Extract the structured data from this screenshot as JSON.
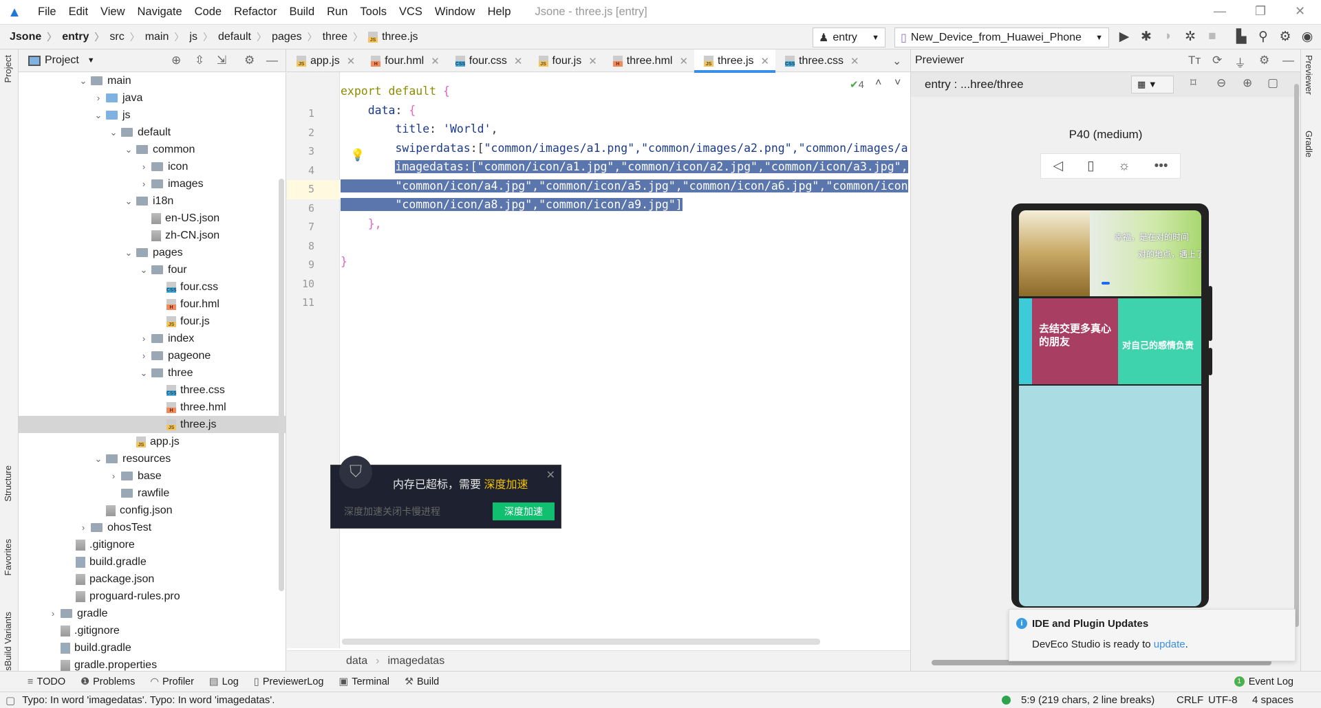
{
  "menubar": {
    "items": [
      "File",
      "Edit",
      "View",
      "Navigate",
      "Code",
      "Refactor",
      "Build",
      "Run",
      "Tools",
      "VCS",
      "Window",
      "Help"
    ],
    "title": "Jsone - three.js [entry]"
  },
  "breadcrumb": [
    "Jsone",
    "entry",
    "src",
    "main",
    "js",
    "default",
    "pages",
    "three",
    "three.js"
  ],
  "toolbar": {
    "module": "entry",
    "device": "New_Device_from_Huawei_Phone"
  },
  "sidestripe": {
    "project": "Project",
    "structure": "Structure",
    "favorites": "Favorites",
    "variants": "OhosBuild Variants",
    "previewer": "Previewer",
    "gradle": "Gradle"
  },
  "project": {
    "title": "Project",
    "tree": [
      {
        "label": "main",
        "depth": 4,
        "type": "folder",
        "open": true
      },
      {
        "label": "java",
        "depth": 5,
        "type": "folder-blue",
        "open": false
      },
      {
        "label": "js",
        "depth": 5,
        "type": "folder-blue",
        "open": true
      },
      {
        "label": "default",
        "depth": 6,
        "type": "folder",
        "open": true
      },
      {
        "label": "common",
        "depth": 7,
        "type": "folder",
        "open": true
      },
      {
        "label": "icon",
        "depth": 8,
        "type": "folder",
        "open": false
      },
      {
        "label": "images",
        "depth": 8,
        "type": "folder",
        "open": false
      },
      {
        "label": "i18n",
        "depth": 7,
        "type": "folder",
        "open": true
      },
      {
        "label": "en-US.json",
        "depth": 8,
        "type": "json"
      },
      {
        "label": "zh-CN.json",
        "depth": 8,
        "type": "json"
      },
      {
        "label": "pages",
        "depth": 7,
        "type": "folder",
        "open": true
      },
      {
        "label": "four",
        "depth": 8,
        "type": "folder",
        "open": true
      },
      {
        "label": "four.css",
        "depth": 9,
        "type": "css"
      },
      {
        "label": "four.hml",
        "depth": 9,
        "type": "h"
      },
      {
        "label": "four.js",
        "depth": 9,
        "type": "js"
      },
      {
        "label": "index",
        "depth": 8,
        "type": "folder",
        "open": false
      },
      {
        "label": "pageone",
        "depth": 8,
        "type": "folder",
        "open": false
      },
      {
        "label": "three",
        "depth": 8,
        "type": "folder",
        "open": true
      },
      {
        "label": "three.css",
        "depth": 9,
        "type": "css"
      },
      {
        "label": "three.hml",
        "depth": 9,
        "type": "h"
      },
      {
        "label": "three.js",
        "depth": 9,
        "type": "js",
        "selected": true
      },
      {
        "label": "app.js",
        "depth": 7,
        "type": "js"
      },
      {
        "label": "resources",
        "depth": 5,
        "type": "folder",
        "open": true
      },
      {
        "label": "base",
        "depth": 6,
        "type": "folder",
        "open": false
      },
      {
        "label": "rawfile",
        "depth": 6,
        "type": "folder-leaf"
      },
      {
        "label": "config.json",
        "depth": 5,
        "type": "json"
      },
      {
        "label": "ohosTest",
        "depth": 4,
        "type": "folder",
        "open": false
      },
      {
        "label": ".gitignore",
        "depth": 3,
        "type": "file"
      },
      {
        "label": "build.gradle",
        "depth": 3,
        "type": "gradle"
      },
      {
        "label": "package.json",
        "depth": 3,
        "type": "json"
      },
      {
        "label": "proguard-rules.pro",
        "depth": 3,
        "type": "file"
      },
      {
        "label": "gradle",
        "depth": 2,
        "type": "folder",
        "open": false
      },
      {
        "label": ".gitignore",
        "depth": 2,
        "type": "file"
      },
      {
        "label": "build.gradle",
        "depth": 2,
        "type": "gradle"
      },
      {
        "label": "gradle.properties",
        "depth": 2,
        "type": "file"
      }
    ]
  },
  "tabs": [
    {
      "label": "app.js",
      "type": "js"
    },
    {
      "label": "four.hml",
      "type": "h"
    },
    {
      "label": "four.css",
      "type": "css"
    },
    {
      "label": "four.js",
      "type": "js"
    },
    {
      "label": "three.hml",
      "type": "h"
    },
    {
      "label": "three.js",
      "type": "js",
      "active": true
    },
    {
      "label": "three.css",
      "type": "css"
    }
  ],
  "editor": {
    "inspection_count": "4",
    "caret_line": 5,
    "lines": [
      [
        {
          "t": "export default ",
          "c": "kw"
        },
        {
          "t": "{",
          "c": "br"
        }
      ],
      [
        {
          "t": "    data",
          "c": "prop"
        },
        {
          "t": ": ",
          "c": "pl"
        },
        {
          "t": "{",
          "c": "br"
        }
      ],
      [
        {
          "t": "        title",
          "c": "prop"
        },
        {
          "t": ": ",
          "c": "pl"
        },
        {
          "t": "'World'",
          "c": "str"
        },
        {
          "t": ",",
          "c": "pl"
        }
      ],
      [
        {
          "t": "        swiperdatas",
          "c": "prop"
        },
        {
          "t": ":[",
          "c": "pl"
        },
        {
          "t": "\"common/images/a1.png\",\"common/images/a2.png\",\"common/images/a",
          "c": "str"
        }
      ],
      [
        {
          "t": "        ",
          "c": "pl"
        },
        {
          "t": "imagedatas:[\"common/icon/a1.jpg\",\"common/icon/a2.jpg\",\"common/icon/a3.jpg\",",
          "c": "sel-hl"
        }
      ],
      [
        {
          "t": "        \"common/icon/a4.jpg\",\"common/icon/a5.jpg\",\"common/icon/a6.jpg\",\"common/icon",
          "c": "sel-hl"
        }
      ],
      [
        {
          "t": "        \"common/icon/a8.jpg\",\"common/icon/a9.jpg\"]",
          "c": "sel-hl"
        }
      ],
      [
        {
          "t": "    },",
          "c": "br"
        }
      ],
      [
        {
          "t": "",
          "c": "pl"
        }
      ],
      [
        {
          "t": "}",
          "c": "br"
        }
      ],
      [
        {
          "t": "",
          "c": "pl"
        }
      ]
    ],
    "breadcrumb": [
      "data",
      "imagedatas"
    ]
  },
  "previewer": {
    "title": "Previewer",
    "path": "entry : ...hree/three",
    "device": "P40 (medium)",
    "cards": [
      {
        "title": "去结交更多真心的朋友",
        "color": "#a83e62"
      },
      {
        "title": "对自己的感情负责",
        "color": "#3fd3ad"
      }
    ],
    "banner_text": [
      "幸福，是在对的时间",
      "对的地点，遇上了对的人"
    ],
    "bg_color": "#a9dce3"
  },
  "popup": {
    "message": "内存已超标，需要 ",
    "highlight": "深度加速",
    "sub": "深度加速关闭卡慢进程",
    "button": "深度加速"
  },
  "notification": {
    "title": "IDE and Plugin Updates",
    "text": "DevEco Studio is ready to ",
    "link": "update",
    "end": "."
  },
  "tooltabs": [
    {
      "label": "TODO",
      "icon": "≡"
    },
    {
      "label": "Problems",
      "icon": "❶"
    },
    {
      "label": "Profiler",
      "icon": "◠"
    },
    {
      "label": "Log",
      "icon": "▤"
    },
    {
      "label": "PreviewerLog",
      "icon": "▯"
    },
    {
      "label": "Terminal",
      "icon": "▣"
    },
    {
      "label": "Build",
      "icon": "⚒"
    }
  ],
  "eventlog": {
    "count": "1",
    "label": "Event Log"
  },
  "status": {
    "message": "Typo: In word 'imagedatas'. Typo: In word 'imagedatas'.",
    "position": "5:9 (219 chars, 2 line breaks)",
    "line_sep": "CRLF",
    "encoding": "UTF-8",
    "indent": "4 spaces"
  }
}
